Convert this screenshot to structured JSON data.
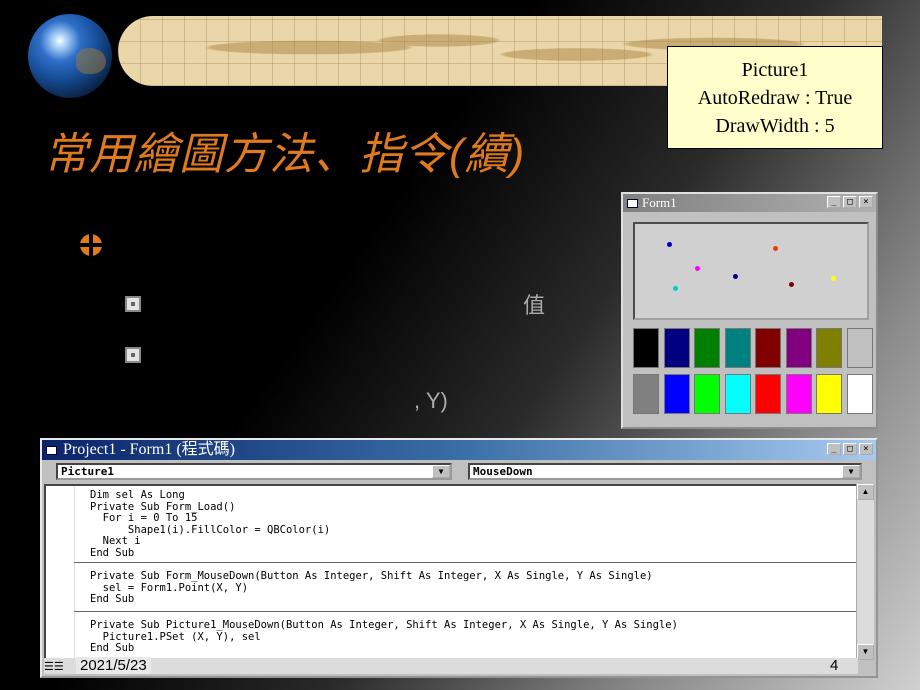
{
  "slide": {
    "title": "常用繪圖方法、指令(續)",
    "peek_text_1": "值",
    "peek_text_2": ", Y)",
    "date": "2021/5/23",
    "page_number": "4"
  },
  "note": {
    "line1": "Picture1",
    "line2": "AutoRedraw : True",
    "line3": "DrawWidth : 5"
  },
  "form_window": {
    "title": "Form1",
    "min_label": "_",
    "max_label": "□",
    "close_label": "×",
    "dot_colors": [
      "#0000cc",
      "#ff00ff",
      "#00cccc",
      "#000080",
      "#ff3300",
      "#800000",
      "#ffff00"
    ],
    "palette_colors": [
      "#000000",
      "#000080",
      "#008000",
      "#008080",
      "#800000",
      "#800080",
      "#808000",
      "#c0c0c0",
      "#808080",
      "#0000ff",
      "#00ff00",
      "#00ffff",
      "#ff0000",
      "#ff00ff",
      "#ffff00",
      "#ffffff"
    ]
  },
  "code_window": {
    "title": "Project1 - Form1 (程式碼)",
    "object_combo": "Picture1",
    "proc_combo": "MouseDown",
    "code_blocks": [
      "Dim sel As Long\nPrivate Sub Form_Load()\n  For i = 0 To 15\n      Shape1(i).FillColor = QBColor(i)\n  Next i\nEnd Sub",
      "Private Sub Form_MouseDown(Button As Integer, Shift As Integer, X As Single, Y As Single)\n  sel = Form1.Point(X, Y)\nEnd Sub",
      "Private Sub Picture1_MouseDown(Button As Integer, Shift As Integer, X As Single, Y As Single)\n  Picture1.PSet (X, Y), sel\nEnd Sub"
    ]
  }
}
